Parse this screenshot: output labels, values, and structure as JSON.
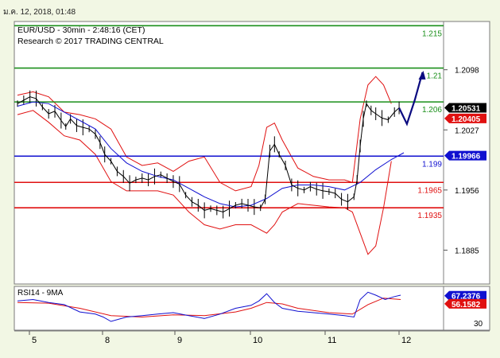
{
  "header": {
    "timestamp": "ม.ค. 12, 2018, 01:48"
  },
  "chart_data": {
    "type": "line",
    "title": "EUR/USD - 30min - 2:48:16 (CET)",
    "subtitle": "Research © 2017 TRADING CENTRAL",
    "x_ticks": [
      "5",
      "8",
      "9",
      "10",
      "11",
      "12"
    ],
    "y_ticks": [
      "1.2098",
      "1.2027",
      "1.1956",
      "1.1885"
    ],
    "ylim": [
      1.1845,
      1.2155
    ],
    "grid": false,
    "levels": [
      {
        "label": "1.215",
        "value": 1.215,
        "color": "#1a8f1a"
      },
      {
        "label": "1.21",
        "value": 1.21,
        "color": "#1a8f1a"
      },
      {
        "label": "1.206",
        "value": 1.206,
        "color": "#1a8f1a"
      },
      {
        "label": "1.199",
        "value": 1.1996,
        "color": "#1010d0"
      },
      {
        "label": "1.1965",
        "value": 1.1965,
        "color": "#e01010"
      },
      {
        "label": "1.1935",
        "value": 1.1935,
        "color": "#e01010"
      }
    ],
    "price_tags": [
      {
        "label": "1.20531",
        "value": 1.20531,
        "bg": "#000000"
      },
      {
        "label": "1.20405",
        "value": 1.20405,
        "bg": "#e01010"
      },
      {
        "label": "1.19966",
        "value": 1.19966,
        "bg": "#1010d0"
      }
    ],
    "price_series": [
      [
        0,
        1.2058
      ],
      [
        4,
        1.2062
      ],
      [
        8,
        1.2066
      ],
      [
        12,
        1.2064
      ],
      [
        16,
        1.2054
      ],
      [
        20,
        1.2046
      ],
      [
        24,
        1.2049
      ],
      [
        28,
        1.2038
      ],
      [
        31,
        1.2031
      ],
      [
        34,
        1.204
      ],
      [
        38,
        1.2032
      ],
      [
        42,
        1.203
      ],
      [
        46,
        1.2028
      ],
      [
        50,
        1.2022
      ],
      [
        53,
        1.2012
      ],
      [
        56,
        1.1998
      ],
      [
        60,
        1.199
      ],
      [
        64,
        1.1978
      ],
      [
        68,
        1.1972
      ],
      [
        72,
        1.1964
      ],
      [
        76,
        1.1968
      ],
      [
        80,
        1.197
      ],
      [
        84,
        1.1968
      ],
      [
        88,
        1.1972
      ],
      [
        92,
        1.1974
      ],
      [
        96,
        1.197
      ],
      [
        100,
        1.1966
      ],
      [
        104,
        1.1963
      ],
      [
        108,
        1.195
      ],
      [
        112,
        1.1942
      ],
      [
        116,
        1.1938
      ],
      [
        120,
        1.1932
      ],
      [
        124,
        1.1934
      ],
      [
        128,
        1.1932
      ],
      [
        132,
        1.193
      ],
      [
        136,
        1.1934
      ],
      [
        140,
        1.1938
      ],
      [
        144,
        1.194
      ],
      [
        148,
        1.1938
      ],
      [
        152,
        1.1936
      ],
      [
        156,
        1.1935
      ],
      [
        159,
        1.1945
      ],
      [
        162,
        1.2002
      ],
      [
        165,
        1.201
      ],
      [
        168,
        1.1998
      ],
      [
        172,
        1.1985
      ],
      [
        176,
        1.1962
      ],
      [
        180,
        1.1958
      ],
      [
        184,
        1.1956
      ],
      [
        188,
        1.196
      ],
      [
        192,
        1.1957
      ],
      [
        196,
        1.1955
      ],
      [
        200,
        1.1954
      ],
      [
        204,
        1.1952
      ],
      [
        208,
        1.1945
      ],
      [
        212,
        1.1942
      ],
      [
        216,
        1.1948
      ],
      [
        218,
        1.1968
      ],
      [
        220,
        1.2008
      ],
      [
        222,
        1.204
      ],
      [
        224,
        1.2058
      ],
      [
        227,
        1.205
      ],
      [
        230,
        1.2046
      ],
      [
        234,
        1.2041
      ],
      [
        238,
        1.2039
      ],
      [
        242,
        1.2048
      ],
      [
        245,
        1.2053
      ]
    ],
    "sma_series": [
      [
        0,
        1.2055
      ],
      [
        10,
        1.206
      ],
      [
        20,
        1.2058
      ],
      [
        30,
        1.2048
      ],
      [
        40,
        1.2038
      ],
      [
        50,
        1.2028
      ],
      [
        60,
        1.2005
      ],
      [
        70,
        1.1988
      ],
      [
        80,
        1.1978
      ],
      [
        90,
        1.1972
      ],
      [
        100,
        1.1968
      ],
      [
        110,
        1.1958
      ],
      [
        120,
        1.1948
      ],
      [
        130,
        1.194
      ],
      [
        140,
        1.1936
      ],
      [
        150,
        1.1938
      ],
      [
        160,
        1.1946
      ],
      [
        170,
        1.1958
      ],
      [
        180,
        1.1962
      ],
      [
        190,
        1.1962
      ],
      [
        200,
        1.196
      ],
      [
        210,
        1.1956
      ],
      [
        220,
        1.1965
      ],
      [
        230,
        1.198
      ],
      [
        240,
        1.1992
      ],
      [
        248,
        1.2
      ]
    ],
    "band_upper": [
      [
        0,
        1.2068
      ],
      [
        10,
        1.2072
      ],
      [
        20,
        1.2066
      ],
      [
        30,
        1.2048
      ],
      [
        40,
        1.2045
      ],
      [
        50,
        1.204
      ],
      [
        60,
        1.2028
      ],
      [
        70,
        1.1995
      ],
      [
        80,
        1.1985
      ],
      [
        90,
        1.1988
      ],
      [
        100,
        1.1978
      ],
      [
        110,
        1.199
      ],
      [
        120,
        1.1995
      ],
      [
        130,
        1.1965
      ],
      [
        140,
        1.1955
      ],
      [
        150,
        1.196
      ],
      [
        155,
        1.1985
      ],
      [
        160,
        1.203
      ],
      [
        165,
        1.2035
      ],
      [
        170,
        1.2015
      ],
      [
        180,
        1.1982
      ],
      [
        190,
        1.1972
      ],
      [
        200,
        1.1968
      ],
      [
        210,
        1.1968
      ],
      [
        215,
        1.1965
      ],
      [
        220,
        1.204
      ],
      [
        225,
        1.208
      ],
      [
        230,
        1.209
      ],
      [
        235,
        1.208
      ],
      [
        240,
        1.2058
      ]
    ],
    "band_lower": [
      [
        0,
        1.2045
      ],
      [
        10,
        1.205
      ],
      [
        20,
        1.2036
      ],
      [
        30,
        1.202
      ],
      [
        40,
        1.2015
      ],
      [
        50,
        1.1998
      ],
      [
        60,
        1.1966
      ],
      [
        70,
        1.1955
      ],
      [
        80,
        1.1955
      ],
      [
        90,
        1.1955
      ],
      [
        100,
        1.195
      ],
      [
        110,
        1.193
      ],
      [
        120,
        1.1915
      ],
      [
        130,
        1.191
      ],
      [
        140,
        1.1915
      ],
      [
        150,
        1.1915
      ],
      [
        155,
        1.191
      ],
      [
        160,
        1.1905
      ],
      [
        165,
        1.1915
      ],
      [
        170,
        1.193
      ],
      [
        180,
        1.194
      ],
      [
        190,
        1.1938
      ],
      [
        200,
        1.1936
      ],
      [
        210,
        1.1935
      ],
      [
        215,
        1.193
      ],
      [
        220,
        1.1905
      ],
      [
        225,
        1.188
      ],
      [
        230,
        1.189
      ],
      [
        235,
        1.1935
      ],
      [
        240,
        1.199
      ]
    ],
    "forecast": [
      [
        245,
        1.2053
      ],
      [
        250,
        1.2034
      ],
      [
        255,
        1.2062
      ],
      [
        260,
        1.2095
      ]
    ],
    "x_span": [
      0,
      272
    ],
    "rsi": {
      "label": "RSI14 - 9MA",
      "ylim": [
        20,
        80
      ],
      "y_ticks": [
        "30"
      ],
      "tags": [
        {
          "label": "67.2376",
          "value": 67.2376,
          "bg": "#1010d0"
        },
        {
          "label": "56.1582",
          "value": 56.1582,
          "bg": "#e01010"
        }
      ],
      "rsi_series": [
        [
          0,
          60
        ],
        [
          10,
          62
        ],
        [
          20,
          58
        ],
        [
          30,
          55
        ],
        [
          40,
          45
        ],
        [
          50,
          42
        ],
        [
          55,
          38
        ],
        [
          60,
          32
        ],
        [
          70,
          38
        ],
        [
          80,
          40
        ],
        [
          90,
          42
        ],
        [
          100,
          44
        ],
        [
          110,
          40
        ],
        [
          120,
          36
        ],
        [
          130,
          42
        ],
        [
          140,
          50
        ],
        [
          150,
          54
        ],
        [
          155,
          60
        ],
        [
          160,
          70
        ],
        [
          165,
          58
        ],
        [
          170,
          50
        ],
        [
          180,
          46
        ],
        [
          190,
          44
        ],
        [
          200,
          42
        ],
        [
          210,
          40
        ],
        [
          216,
          38
        ],
        [
          220,
          62
        ],
        [
          225,
          72
        ],
        [
          230,
          68
        ],
        [
          236,
          62
        ],
        [
          242,
          66
        ],
        [
          246,
          68
        ]
      ],
      "ma_series": [
        [
          0,
          58
        ],
        [
          20,
          57
        ],
        [
          40,
          50
        ],
        [
          60,
          40
        ],
        [
          80,
          38
        ],
        [
          100,
          41
        ],
        [
          120,
          40
        ],
        [
          140,
          45
        ],
        [
          150,
          50
        ],
        [
          160,
          58
        ],
        [
          170,
          56
        ],
        [
          180,
          50
        ],
        [
          200,
          44
        ],
        [
          215,
          42
        ],
        [
          225,
          55
        ],
        [
          235,
          64
        ],
        [
          246,
          62
        ]
      ]
    }
  }
}
